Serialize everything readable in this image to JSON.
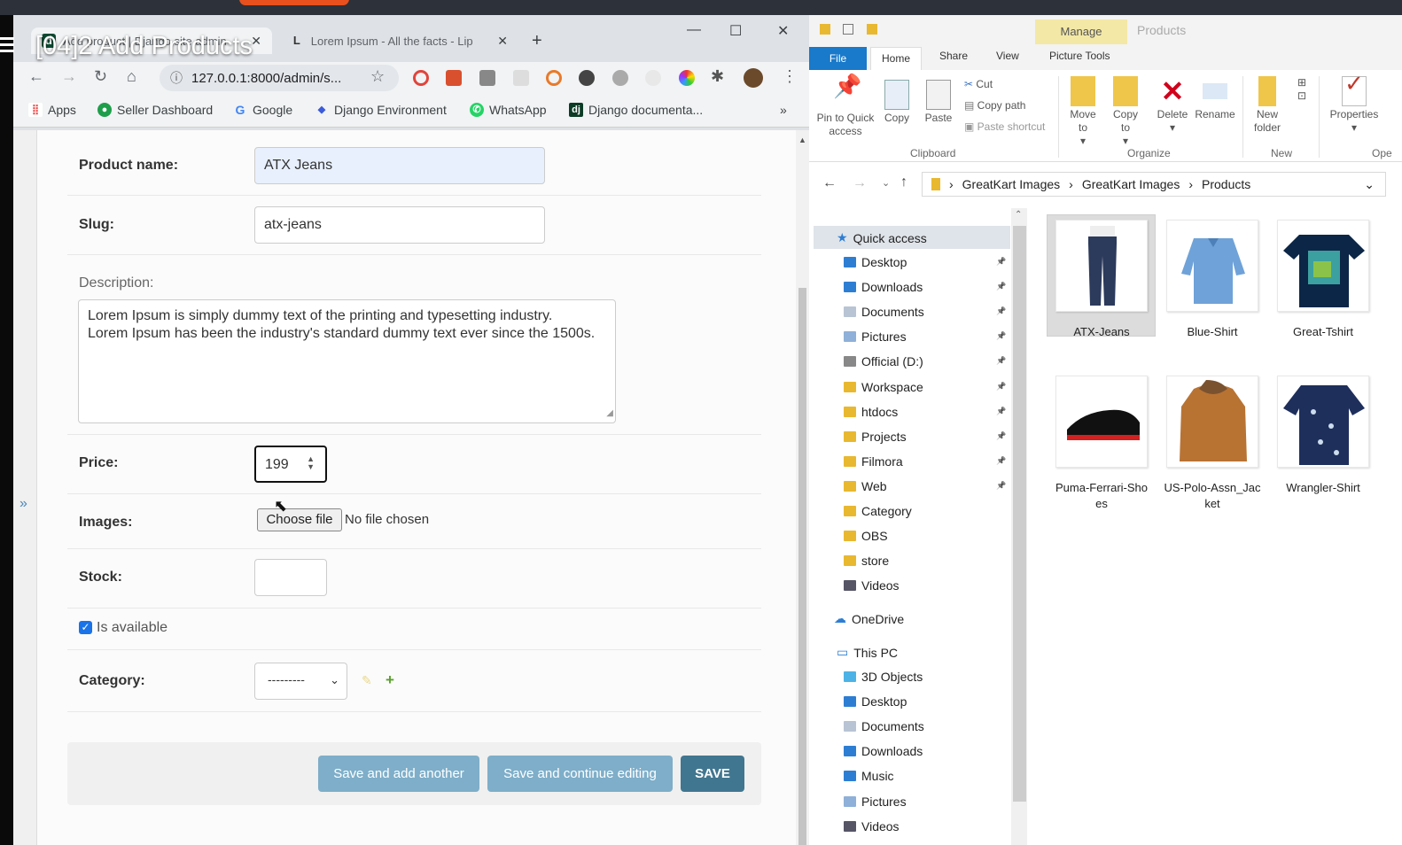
{
  "overlay_title": "[04]2 Add Products",
  "browser": {
    "tabs": [
      {
        "label": "Add product | Django site admin",
        "active": true
      },
      {
        "label": "Lorem Ipsum - All the facts - Lip",
        "active": false
      }
    ],
    "address": "127.0.0.1:8000/admin/s...",
    "bookmarks": [
      "Apps",
      "Seller Dashboard",
      "Google",
      "Django Environment",
      "WhatsApp",
      "Django documenta..."
    ],
    "bookmarks_more": "»"
  },
  "form": {
    "product_name_label": "Product name:",
    "product_name_value": "ATX Jeans",
    "slug_label": "Slug:",
    "slug_value": "atx-jeans",
    "description_label": "Description:",
    "description_line1": "Lorem Ipsum is simply dummy text of the printing and typesetting industry.",
    "description_line2": "Lorem Ipsum has been the industry's standard dummy text ever since the 1500s.",
    "price_label": "Price:",
    "price_value": "199",
    "images_label": "Images:",
    "choose_file": "Choose file",
    "no_file": "No file chosen",
    "stock_label": "Stock:",
    "stock_value": "",
    "is_available_label": "Is available",
    "is_available_checked": true,
    "category_label": "Category:",
    "category_value": "---------",
    "buttons": {
      "save_add": "Save and add another",
      "save_continue": "Save and continue editing",
      "save": "SAVE"
    }
  },
  "sidebar_toggle": "»",
  "explorer": {
    "title": "Products",
    "manage_tab": "Manage",
    "tabs": [
      "File",
      "Home",
      "Share",
      "View",
      "Picture Tools"
    ],
    "ribbon": {
      "pin": "Pin to Quick access",
      "copy": "Copy",
      "paste": "Paste",
      "cut": "Cut",
      "copy_path": "Copy path",
      "paste_shortcut": "Paste shortcut",
      "move_to": "Move to",
      "copy_to": "Copy to",
      "delete": "Delete",
      "rename": "Rename",
      "new_folder": "New folder",
      "properties": "Properties",
      "groups": [
        "Clipboard",
        "Organize",
        "New",
        "Ope"
      ]
    },
    "path": [
      "GreatKart Images",
      "GreatKart Images",
      "Products"
    ],
    "quick_access": "Quick access",
    "tree_quick": [
      "Desktop",
      "Downloads",
      "Documents",
      "Pictures",
      "Official (D:)",
      "Workspace",
      "htdocs",
      "Projects",
      "Filmora",
      "Web",
      "Category",
      "OBS",
      "store",
      "Videos"
    ],
    "onedrive": "OneDrive",
    "this_pc": "This PC",
    "tree_pc": [
      "3D Objects",
      "Desktop",
      "Documents",
      "Downloads",
      "Music",
      "Pictures",
      "Videos"
    ],
    "files": [
      {
        "name": "ATX-Jeans",
        "selected": true
      },
      {
        "name": "Blue-Shirt"
      },
      {
        "name": "Great-Tshirt"
      },
      {
        "name": "Puma-Ferrari-Sho\nes"
      },
      {
        "name": "US-Polo-Assn_Jac\nket"
      },
      {
        "name": "Wrangler-Shirt"
      }
    ]
  },
  "colors": {
    "django_blue": "#417690",
    "chrome_bg": "#dee1e6",
    "explorer_file_tab": "#1979ca"
  }
}
